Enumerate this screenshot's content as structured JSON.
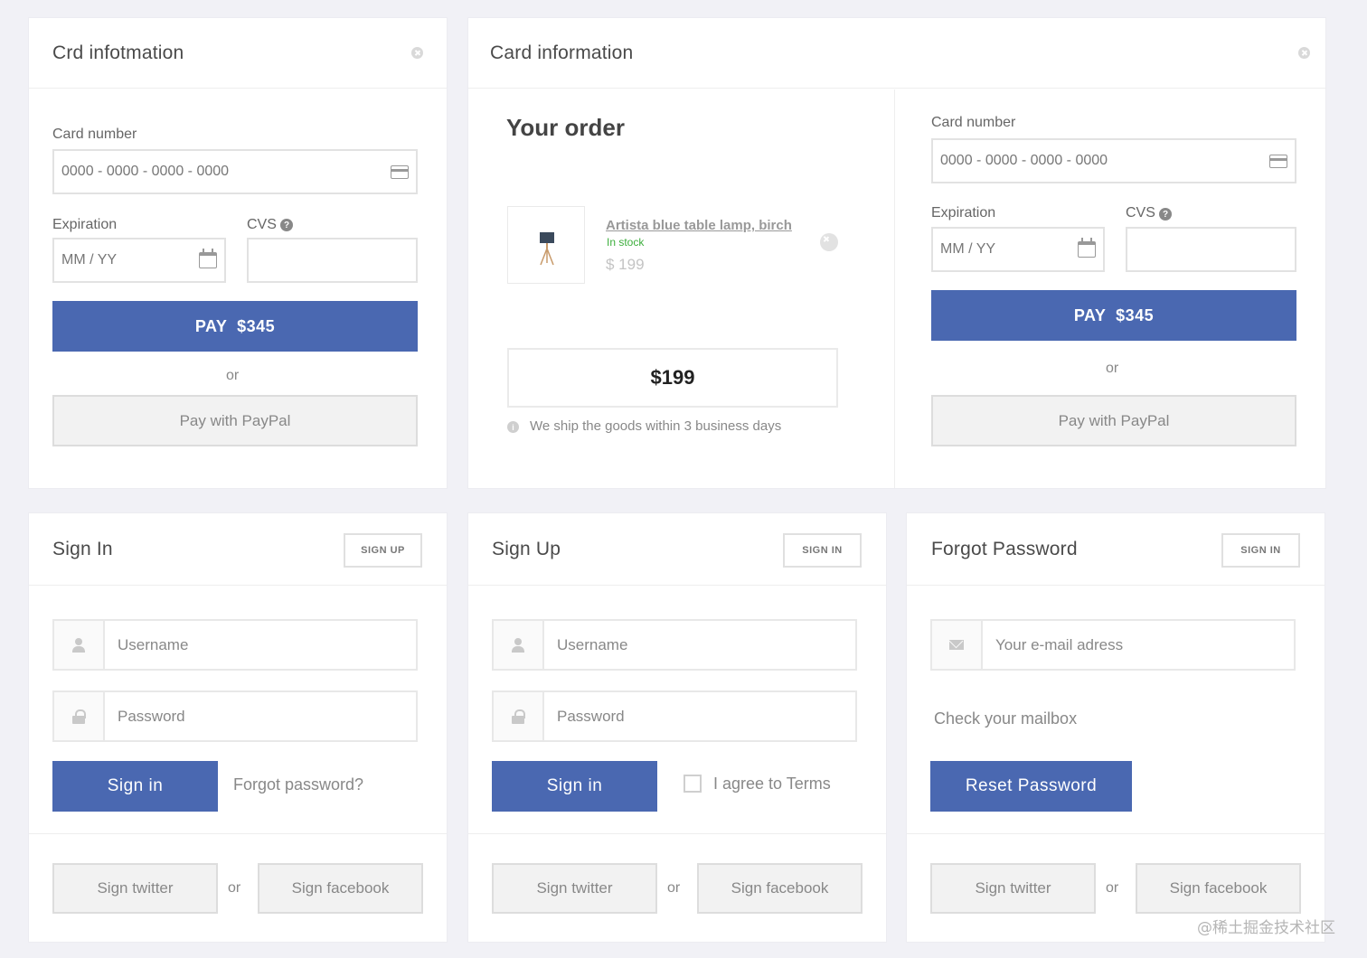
{
  "card_small": {
    "title": "Crd infotmation",
    "card_number_label": "Card number",
    "card_number_placeholder": "0000 - 0000 - 0000 - 0000",
    "expiration_label": "Expiration",
    "expiration_placeholder": "MM / YY",
    "cvs_label": "CVS",
    "pay_label": "PAY  $345",
    "or": "or",
    "paypal_label": "Pay with PayPal"
  },
  "card_large": {
    "title": "Card information",
    "order": {
      "heading": "Your order",
      "product_name": "Artista blue table lamp, birch",
      "stock_status": "In stock",
      "price": "$ 199",
      "total": "$199",
      "shipping_note": "We ship the goods within 3 business days"
    },
    "card_number_label": "Card number",
    "card_number_placeholder": "0000 - 0000 - 0000 - 0000",
    "expiration_label": "Expiration",
    "expiration_placeholder": "MM / YY",
    "cvs_label": "CVS",
    "pay_label": "PAY  $345",
    "or": "or",
    "paypal_label": "Pay with PayPal"
  },
  "sign_in": {
    "title": "Sign In",
    "switch_label": "SIGN UP",
    "username_placeholder": "Username",
    "password_placeholder": "Password",
    "submit_label": "Sign in",
    "forgot_label": "Forgot password?",
    "twitter_label": "Sign twitter",
    "or": "or",
    "facebook_label": "Sign facebook"
  },
  "sign_up": {
    "title": "Sign Up",
    "switch_label": "SIGN IN",
    "username_placeholder": "Username",
    "password_placeholder": "Password",
    "submit_label": "Sign in",
    "terms_label": "I agree to Terms",
    "twitter_label": "Sign twitter",
    "or": "or",
    "facebook_label": "Sign facebook"
  },
  "forgot": {
    "title": "Forgot Password",
    "switch_label": "SIGN IN",
    "email_placeholder": "Your e-mail adress",
    "check_mailbox": "Check your mailbox",
    "reset_label": "Reset Password",
    "twitter_label": "Sign twitter",
    "or": "or",
    "facebook_label": "Sign facebook"
  },
  "watermark": "@稀土掘金技术社区",
  "colors": {
    "primary": "#4a68b1",
    "background": "#f1f1f6",
    "in_stock": "#3cae3c"
  }
}
